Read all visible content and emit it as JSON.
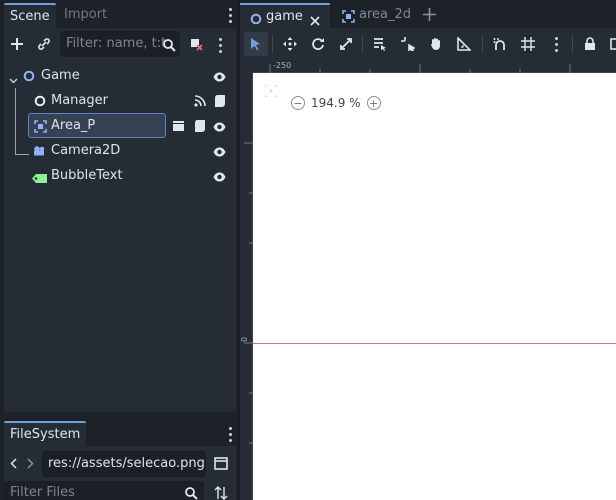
{
  "scene_dock": {
    "tabs": [
      {
        "label": "Scene",
        "active": true
      },
      {
        "label": "Import",
        "active": false
      }
    ],
    "filter": {
      "placeholder": "Filter: name, t:t"
    },
    "tree": [
      {
        "name": "Game",
        "icon": "node2d-circle-icon",
        "icon_color": "#8fb3f3",
        "depth": 0,
        "selected": false,
        "extras": []
      },
      {
        "name": "Manager",
        "icon": "node-circle-icon",
        "icon_color": "#e9eef3",
        "depth": 1,
        "selected": false,
        "extras": [
          "signal-icon",
          "script-icon"
        ]
      },
      {
        "name": "Area_P",
        "icon": "area2d-icon",
        "icon_color": "#8fb3f3",
        "depth": 1,
        "selected": true,
        "extras": [
          "clapper-icon",
          "script-icon"
        ]
      },
      {
        "name": "Camera2D",
        "icon": "camera-icon",
        "icon_color": "#8fb3f3",
        "depth": 1,
        "selected": false,
        "extras": []
      },
      {
        "name": "BubbleText",
        "icon": "label-icon",
        "icon_color": "#8eef97",
        "depth": 1,
        "selected": false,
        "extras": []
      }
    ]
  },
  "filesystem_dock": {
    "tab": "FileSystem",
    "path": "res://assets/selecao.png",
    "filter_placeholder": "Filter Files"
  },
  "editor": {
    "tabs": [
      {
        "label": "game",
        "active": true,
        "closable": true
      },
      {
        "label": "area_2d",
        "active": false,
        "closable": false
      }
    ],
    "add_tab_icon": "plus-icon",
    "toolbar_icons": [
      "select-icon",
      "move-icon",
      "rotate-icon",
      "scale-icon",
      "list-select-icon",
      "pivot-icon",
      "pan-icon",
      "ruler-icon",
      "snap-icon",
      "grid-snap-icon",
      "more-icon",
      "lock-icon"
    ],
    "ruler_top_label": "-250",
    "ruler_left_label": "0",
    "zoom": "194.9 %"
  },
  "colors": {
    "accent": "#6da0dd",
    "axis_x": "#e06b7a",
    "canvas_bg": "#ffffff"
  }
}
